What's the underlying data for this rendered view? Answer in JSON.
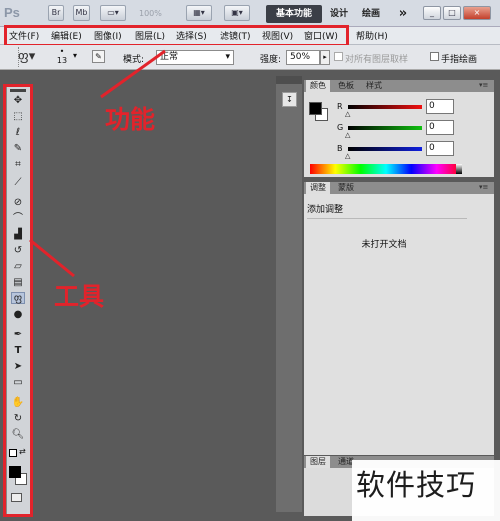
{
  "app": {
    "logo": "Ps"
  },
  "titlebar": {
    "bridge_label": "Br",
    "minibridge_label": "Mb",
    "zoom_value": "100%",
    "workspaces": [
      "基本功能",
      "设计",
      "绘画"
    ],
    "more_label": "»",
    "window_controls": [
      "_",
      "□",
      "×"
    ]
  },
  "menu": {
    "items": [
      "文件(F)",
      "编辑(E)",
      "图像(I)",
      "图层(L)",
      "选择(S)",
      "滤镜(T)",
      "视图(V)",
      "窗口(W)",
      "帮助(H)"
    ]
  },
  "options": {
    "brush_size": "13",
    "mode_label": "模式:",
    "mode_value": "正常",
    "strength_label": "强度:",
    "strength_value": "50%",
    "sample_all_label": "对所有图层取样",
    "finger_paint_label": "手指绘画"
  },
  "annotations": {
    "menu_label": "功能",
    "tools_label": "工具",
    "color": "#e2232b"
  },
  "panels": {
    "color": {
      "tabs": [
        "颜色",
        "色板",
        "样式"
      ],
      "channels": [
        {
          "label": "R",
          "value": "0",
          "color": "#d01010"
        },
        {
          "label": "G",
          "value": "0",
          "color": "#10b010"
        },
        {
          "label": "B",
          "value": "0",
          "color": "#1020d0"
        }
      ]
    },
    "adjust": {
      "tabs": [
        "调整",
        "蒙版"
      ],
      "title": "添加调整",
      "message": "未打开文档"
    },
    "layers": {
      "tabs": [
        "图层",
        "通道"
      ]
    }
  },
  "watermark": "软件技巧"
}
